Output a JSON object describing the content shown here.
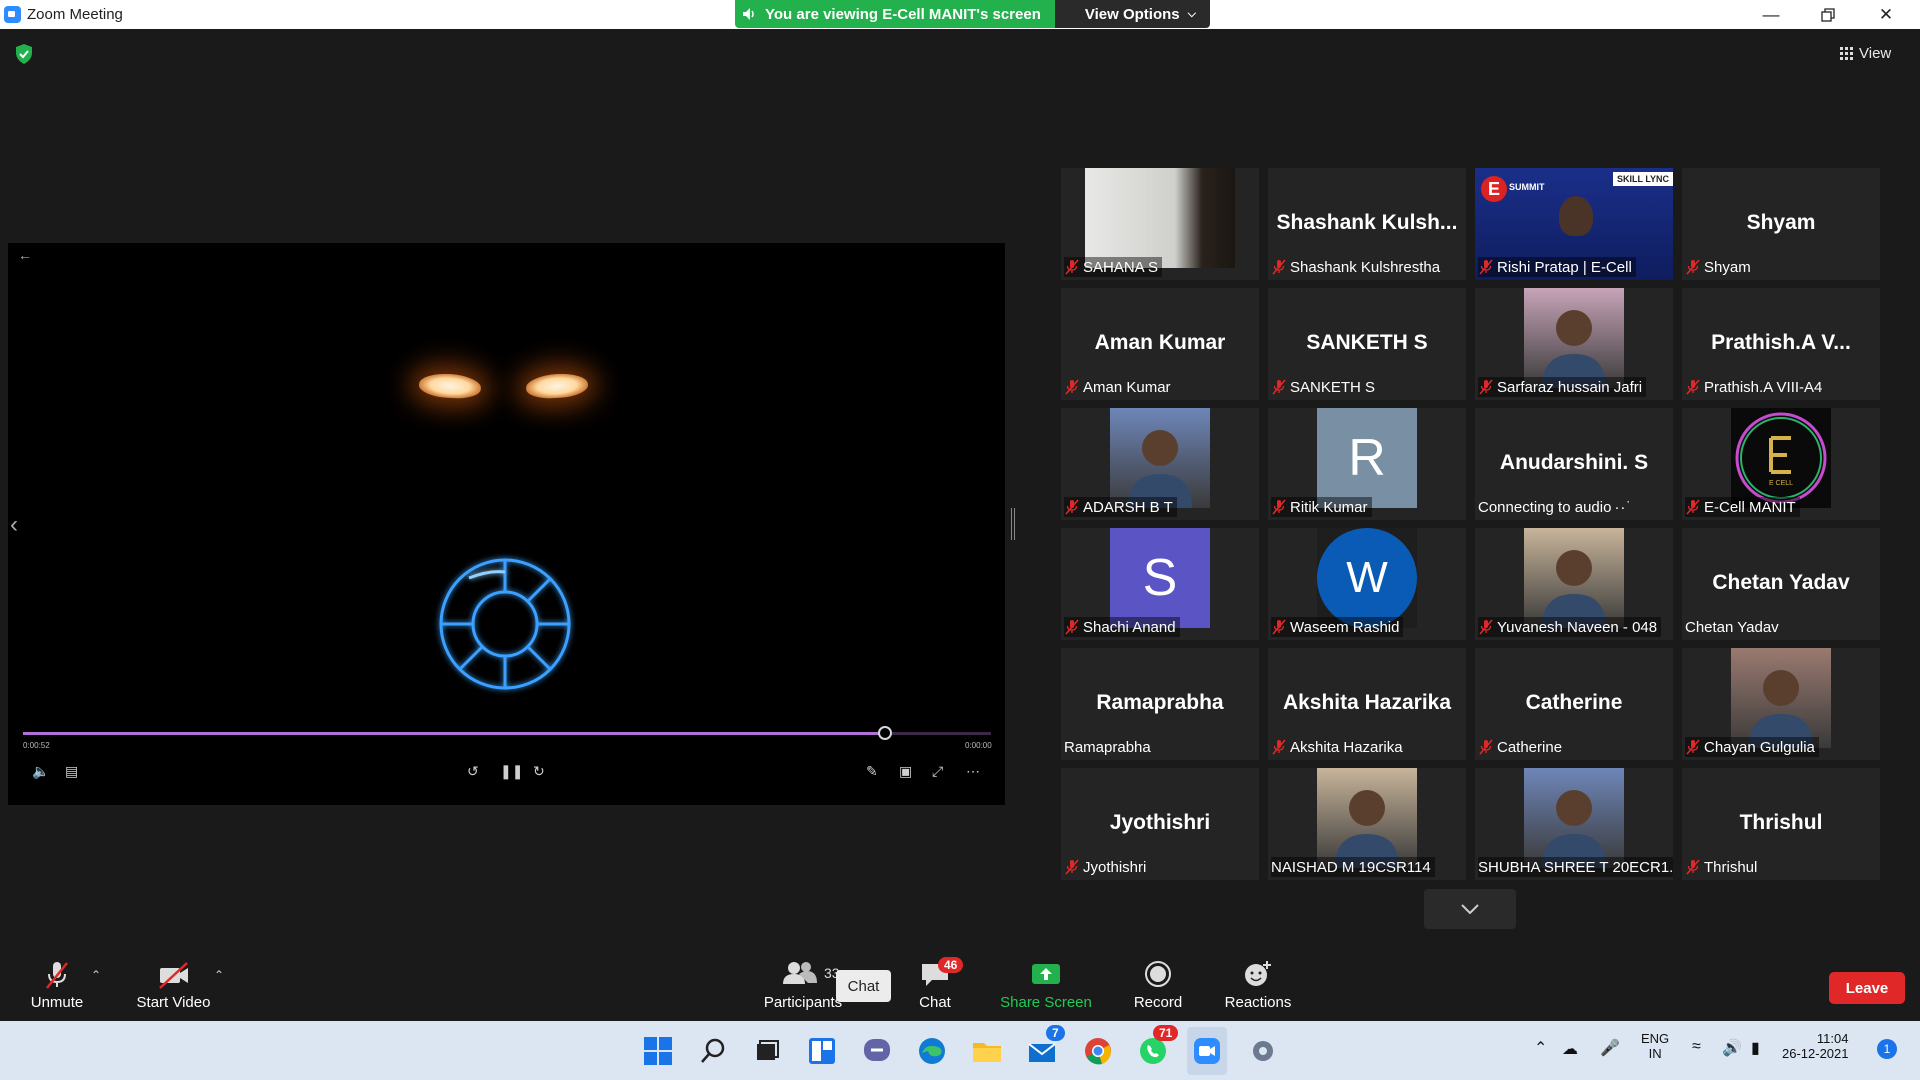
{
  "window": {
    "title": "Zoom Meeting"
  },
  "share_banner": {
    "message": "You are viewing E-Cell MANIT's screen",
    "view_options": "View Options"
  },
  "top_right": {
    "view_label": "View"
  },
  "player": {
    "current_time": "0:00:52",
    "duration": "0:00:00",
    "progress_percent": 89
  },
  "participants": [
    {
      "display_name": "",
      "label": "SAHANA S",
      "muted": true,
      "avatar": "photo"
    },
    {
      "display_name": "Shashank  Kulsh...",
      "label": "Shashank Kulshrestha",
      "muted": true,
      "avatar": "none"
    },
    {
      "display_name": "",
      "label": "Rishi Pratap | E-Cell",
      "muted": true,
      "avatar": "video"
    },
    {
      "display_name": "Shyam",
      "label": "Shyam",
      "muted": true,
      "avatar": "none"
    },
    {
      "display_name": "Aman Kumar",
      "label": "Aman Kumar",
      "muted": true,
      "avatar": "none"
    },
    {
      "display_name": "SANKETH S",
      "label": "SANKETH S",
      "muted": true,
      "avatar": "none"
    },
    {
      "display_name": "",
      "label": "Sarfaraz hussain Jafri",
      "muted": true,
      "avatar": "photo"
    },
    {
      "display_name": "Prathish.A       V...",
      "label": "Prathish.A      VIII-A4",
      "muted": true,
      "avatar": "none"
    },
    {
      "display_name": "",
      "label": "ADARSH B T",
      "muted": true,
      "avatar": "photo"
    },
    {
      "display_name": "",
      "label": "Ritik Kumar",
      "muted": true,
      "avatar": "letter",
      "letter": "R"
    },
    {
      "display_name": "Anudarshini. S",
      "label": "Connecting to audio",
      "muted": false,
      "avatar": "none",
      "connecting": true
    },
    {
      "display_name": "",
      "label": "E-Cell MANIT",
      "muted": true,
      "avatar": "logo"
    },
    {
      "display_name": "",
      "label": "Shachi Anand",
      "muted": true,
      "avatar": "letter",
      "letter": "S"
    },
    {
      "display_name": "",
      "label": "Waseem Rashid",
      "muted": true,
      "avatar": "letter",
      "letter": "W"
    },
    {
      "display_name": "",
      "label": "Yuvanesh Naveen - 048",
      "muted": true,
      "avatar": "photo"
    },
    {
      "display_name": "Chetan Yadav",
      "label": "Chetan Yadav",
      "muted": false,
      "avatar": "none"
    },
    {
      "display_name": "Ramaprabha",
      "label": "Ramaprabha",
      "muted": false,
      "avatar": "none"
    },
    {
      "display_name": "Akshita Hazarika",
      "label": "Akshita Hazarika",
      "muted": true,
      "avatar": "none"
    },
    {
      "display_name": "Catherine",
      "label": "Catherine",
      "muted": true,
      "avatar": "none"
    },
    {
      "display_name": "",
      "label": "Chayan Gulgulia",
      "muted": true,
      "avatar": "photo"
    },
    {
      "display_name": "Jyothishri",
      "label": "Jyothishri",
      "muted": true,
      "avatar": "none"
    },
    {
      "display_name": "",
      "label": "NAISHAD  M 19CSR114",
      "muted": false,
      "avatar": "photo"
    },
    {
      "display_name": "",
      "label": "SHUBHA SHREE T 20ECR1...",
      "muted": false,
      "avatar": "photo"
    },
    {
      "display_name": "Thrishul",
      "label": "Thrishul",
      "muted": true,
      "avatar": "none"
    }
  ],
  "video_tile": {
    "summit_text": "SUMMIT",
    "sponsor_text": "SKILL LYNC"
  },
  "logo_tile": {
    "text": "E CELL"
  },
  "toolbar": {
    "unmute": "Unmute",
    "start_video": "Start Video",
    "participants": "Participants",
    "participants_count": "33",
    "chat": "Chat",
    "chat_badge": "46",
    "chat_tooltip": "Chat",
    "share_screen": "Share Screen",
    "record": "Record",
    "reactions": "Reactions",
    "leave": "Leave"
  },
  "taskbar": {
    "mail_badge": "7",
    "whatsapp_badge": "71",
    "lang_top": "ENG",
    "lang_bottom": "IN",
    "time": "11:04",
    "date": "26-12-2021",
    "notification_count": "1"
  },
  "colors": {
    "accent_green": "#23b14d",
    "leave_red": "#e02828",
    "mute_red": "#e02828",
    "progress_purple": "#b270d8"
  }
}
